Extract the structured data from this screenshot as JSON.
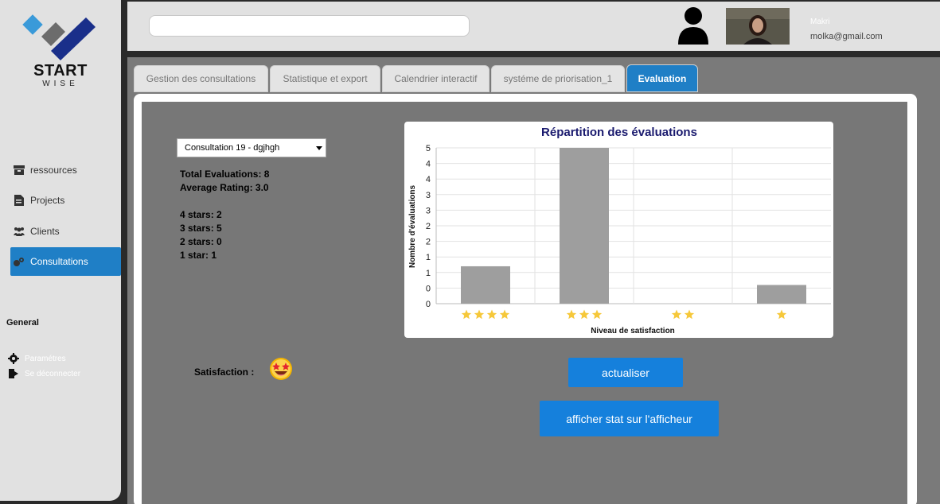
{
  "brand": {
    "name_line1": "START",
    "name_line2": "WISE",
    "colors": {
      "light_blue": "#3a9ad9",
      "navy": "#1a2f8a",
      "grey": "#6c6c6c"
    }
  },
  "sidebar": {
    "items": [
      {
        "label": "ressources",
        "icon": "box-icon"
      },
      {
        "label": "Projects",
        "icon": "document-icon"
      },
      {
        "label": "Clients",
        "icon": "users-icon"
      },
      {
        "label": "Consultations",
        "icon": "consultation-icon",
        "active": true
      }
    ],
    "general_title": "General",
    "general_items": [
      {
        "label": "Paramétres",
        "icon": "gear-icon"
      },
      {
        "label": "Se déconnecter",
        "icon": "logout-icon"
      }
    ]
  },
  "header": {
    "search": {
      "value": "",
      "placeholder": ""
    },
    "user": {
      "name": "Makri",
      "email": "molka@gmail.com"
    }
  },
  "tabs": [
    {
      "label": "Gestion des consultations"
    },
    {
      "label": "Statistique et export"
    },
    {
      "label": "Calendrier interactif"
    },
    {
      "label": "systéme de priorisation_1"
    },
    {
      "label": "Evaluation",
      "active": true
    }
  ],
  "evaluation": {
    "select_value": "Consultation 19 - dgjhgh",
    "total": "Total Evaluations: 8",
    "average": "Average Rating: 3.0",
    "breakdown": [
      "4 stars: 2",
      "3 stars: 5",
      "2 stars: 0",
      "1 star: 1"
    ],
    "satisfaction_label": "Satisfaction :",
    "refresh_button": "actualiser",
    "display_button": "afficher stat sur l'afficheur"
  },
  "chart_data": {
    "type": "bar",
    "title": "Répartition des évaluations",
    "xlabel": "Niveau de satisfaction",
    "ylabel": "Nombre d'évaluations",
    "categories": [
      4,
      3,
      2,
      1
    ],
    "category_display": "stars",
    "values": [
      1.2,
      5,
      0,
      0.6
    ],
    "ytick_labels": [
      "0",
      "0",
      "1",
      "1",
      "2",
      "2",
      "3",
      "3",
      "4",
      "4",
      "5"
    ],
    "ylim": [
      0,
      5
    ],
    "grid": true,
    "bar_color": "#9e9e9e",
    "star_color": "#f6c83a",
    "title_color": "#1a1a6e"
  }
}
